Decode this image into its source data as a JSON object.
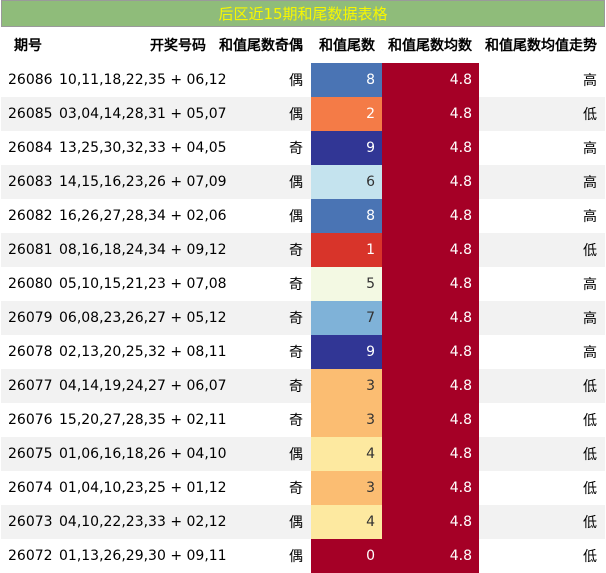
{
  "title": "后区近15期和尾数据表格",
  "headers": {
    "period": "期号",
    "numbers": "开奖号码",
    "parity": "和值尾数奇偶",
    "digit": "和值尾数",
    "average": "和值尾数均数",
    "trend": "和值尾数均值走势"
  },
  "colors": {
    "0": "#a50026",
    "1": "#d73027",
    "2": "#f46d43",
    "3": "#fdae61",
    "4": "#fee090",
    "5": "#ffffbf",
    "6": "#e0f3f8",
    "7": "#abd9e9",
    "8": "#74add1",
    "9": "#4575b4",
    "title_bg": "#8fbc7a",
    "title_text": "#f7f700",
    "average_bg": "#a50026"
  },
  "rows": [
    {
      "period": "26086",
      "numbers": "10,11,18,22,35 + 06,12",
      "parity": "偶",
      "digit": "8",
      "average": "4.8",
      "trend": "高"
    },
    {
      "period": "26085",
      "numbers": "03,04,14,28,31 + 05,07",
      "parity": "偶",
      "digit": "2",
      "average": "4.8",
      "trend": "低"
    },
    {
      "period": "26084",
      "numbers": "13,25,30,32,33 + 04,05",
      "parity": "奇",
      "digit": "9",
      "average": "4.8",
      "trend": "高"
    },
    {
      "period": "26083",
      "numbers": "14,15,16,23,26 + 07,09",
      "parity": "偶",
      "digit": "6",
      "average": "4.8",
      "trend": "高"
    },
    {
      "period": "26082",
      "numbers": "16,26,27,28,34 + 02,06",
      "parity": "偶",
      "digit": "8",
      "average": "4.8",
      "trend": "高"
    },
    {
      "period": "26081",
      "numbers": "08,16,18,24,34 + 09,12",
      "parity": "奇",
      "digit": "1",
      "average": "4.8",
      "trend": "低"
    },
    {
      "period": "26080",
      "numbers": "05,10,15,21,23 + 07,08",
      "parity": "奇",
      "digit": "5",
      "average": "4.8",
      "trend": "高"
    },
    {
      "period": "26079",
      "numbers": "06,08,23,26,27 + 05,12",
      "parity": "奇",
      "digit": "7",
      "average": "4.8",
      "trend": "高"
    },
    {
      "period": "26078",
      "numbers": "02,13,20,25,32 + 08,11",
      "parity": "奇",
      "digit": "9",
      "average": "4.8",
      "trend": "高"
    },
    {
      "period": "26077",
      "numbers": "04,14,19,24,27 + 06,07",
      "parity": "奇",
      "digit": "3",
      "average": "4.8",
      "trend": "低"
    },
    {
      "period": "26076",
      "numbers": "15,20,27,28,35 + 02,11",
      "parity": "奇",
      "digit": "3",
      "average": "4.8",
      "trend": "低"
    },
    {
      "period": "26075",
      "numbers": "01,06,16,18,26 + 04,10",
      "parity": "偶",
      "digit": "4",
      "average": "4.8",
      "trend": "低"
    },
    {
      "period": "26074",
      "numbers": "01,04,10,23,25 + 01,12",
      "parity": "奇",
      "digit": "3",
      "average": "4.8",
      "trend": "低"
    },
    {
      "period": "26073",
      "numbers": "04,10,22,23,33 + 02,12",
      "parity": "偶",
      "digit": "4",
      "average": "4.8",
      "trend": "低"
    },
    {
      "period": "26072",
      "numbers": "01,13,26,29,30 + 09,11",
      "parity": "偶",
      "digit": "0",
      "average": "4.8",
      "trend": "低"
    }
  ]
}
